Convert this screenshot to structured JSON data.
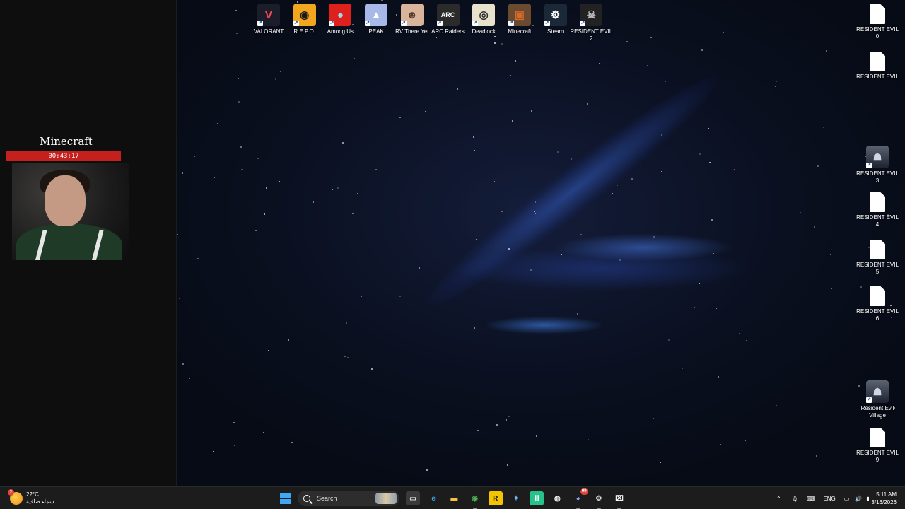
{
  "stream": {
    "title": "Minecraft",
    "timer": "00:43:17"
  },
  "desktop_top_icons": [
    {
      "label": "VALORANT",
      "icon": "valorant-icon",
      "bg": "#1b1e2a",
      "fg": "#ff4655",
      "glyph": "V"
    },
    {
      "label": "R.E.P.O.",
      "icon": "repo-icon",
      "bg": "#f2a51f",
      "fg": "#1a1a1a",
      "glyph": "◉"
    },
    {
      "label": "Among Us",
      "icon": "among-us-icon",
      "bg": "#e0201c",
      "fg": "#9fd9f0",
      "glyph": "●"
    },
    {
      "label": "PEAK",
      "icon": "peak-icon",
      "bg": "#a8b8e8",
      "fg": "#ffffff",
      "glyph": "▲"
    },
    {
      "label": "RV There Yet",
      "icon": "rv-there-yet-icon",
      "bg": "#d7b49a",
      "fg": "#5a3a2a",
      "glyph": "☻"
    },
    {
      "label": "ARC Raiders",
      "icon": "arc-raiders-icon",
      "bg": "#2b2b2b",
      "fg": "#ffffff",
      "glyph": "ARC"
    },
    {
      "label": "Deadlock",
      "icon": "deadlock-icon",
      "bg": "#e8e2cc",
      "fg": "#2b2b2b",
      "glyph": "◎"
    },
    {
      "label": "Minecraft",
      "icon": "minecraft-icon",
      "bg": "#6b4a2f",
      "fg": "#d66a2a",
      "glyph": "▣"
    },
    {
      "label": "Steam",
      "icon": "steam-icon",
      "bg": "#1b2838",
      "fg": "#ffffff",
      "glyph": "⚙"
    },
    {
      "label": "RESIDENT EVIL 2",
      "icon": "resident-evil-2-icon",
      "bg": "#222222",
      "fg": "#bbbbbb",
      "glyph": "☠"
    }
  ],
  "desktop_right_icons": [
    {
      "label": "RESIDENT EVIL 0",
      "icon": "file-icon",
      "type": "file"
    },
    {
      "label": "RESIDENT EVIL",
      "icon": "file-icon",
      "type": "file"
    },
    {
      "label": "RESIDENT EVIL 3",
      "icon": "resident-evil-3-icon",
      "type": "app"
    },
    {
      "label": "RESIDENT EVIL 4",
      "icon": "file-icon",
      "type": "file"
    },
    {
      "label": "RESIDENT EVIL 5",
      "icon": "file-icon",
      "type": "file"
    },
    {
      "label": "RESIDENT EVIL 6",
      "icon": "file-icon",
      "type": "file"
    },
    {
      "label": "Resident Evil Village",
      "icon": "resident-evil-village-icon",
      "type": "app"
    },
    {
      "label": "RESIDENT EVIL 9",
      "icon": "file-icon",
      "type": "file"
    }
  ],
  "taskbar": {
    "weather_temp": "22°C",
    "weather_desc": "سماء صافية",
    "weather_badge": "2",
    "search_label": "Search",
    "apps": [
      {
        "name": "file-manager-icon",
        "glyph": "▭",
        "bg": "#3a3a3a",
        "fg": "#ddd"
      },
      {
        "name": "edge-icon",
        "glyph": "e",
        "bg": "#1c1c1c",
        "fg": "#39b0e8"
      },
      {
        "name": "folder-icon",
        "glyph": "▬",
        "bg": "#1c1c1c",
        "fg": "#f3c443"
      },
      {
        "name": "chrome-icon",
        "glyph": "◉",
        "bg": "#1c1c1c",
        "fg": "#4caf50"
      },
      {
        "name": "rockstar-icon",
        "glyph": "R",
        "bg": "#f5c400",
        "fg": "#111"
      },
      {
        "name": "copilot-icon",
        "glyph": "✦",
        "bg": "#1c1c1c",
        "fg": "#6fb7ff"
      },
      {
        "name": "audio-app-icon",
        "glyph": "Ⅲ",
        "bg": "#27c28c",
        "fg": "#fff"
      },
      {
        "name": "obs-icon",
        "glyph": "◍",
        "bg": "#1c1c1c",
        "fg": "#fff"
      },
      {
        "name": "discord-icon",
        "glyph": "◕",
        "bg": "#1c1c1c",
        "fg": "#8e9cff"
      },
      {
        "name": "settings-icon",
        "glyph": "⚙",
        "bg": "#1c1c1c",
        "fg": "#ddd"
      },
      {
        "name": "capcut-icon",
        "glyph": "⌧",
        "bg": "#1c1c1c",
        "fg": "#fff"
      }
    ],
    "discord_badge": "99",
    "language": "ENG",
    "time": "5:11 AM",
    "date": "3/16/2026"
  }
}
